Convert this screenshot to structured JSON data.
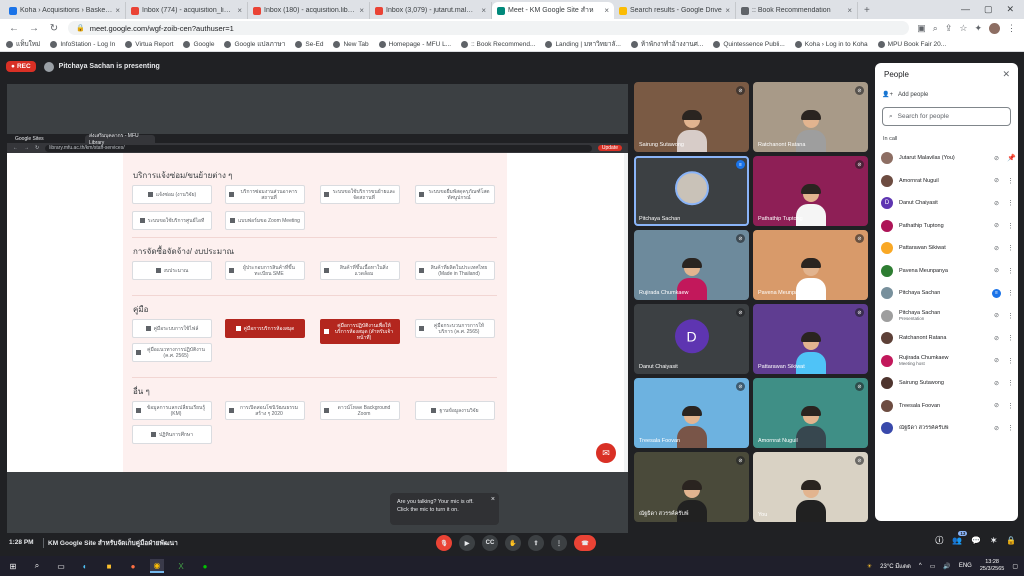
{
  "browser": {
    "tabs": [
      {
        "title": "Koha › Acquisitions › Basket PO:",
        "color": "#1a73e8"
      },
      {
        "title": "Inbox (774) - acquisition_library",
        "color": "#ea4335"
      },
      {
        "title": "Inbox (180) - acquisition.library",
        "color": "#ea4335"
      },
      {
        "title": "Inbox (3,079) - jutarut.mal@mfu",
        "color": "#ea4335"
      },
      {
        "title": "Meet - KM Google Site สำห",
        "color": "#00897b"
      },
      {
        "title": "Search results - Google Drive",
        "color": "#fbbc04"
      },
      {
        "title": ":: Book Recommendation",
        "color": "#5f6368"
      }
    ],
    "url": "meet.google.com/wgf-zoib-cen?authuser=1",
    "bookmarks": [
      "แท็บใหม่",
      "InfoStation - Log In",
      "Virtua Report",
      "Google",
      "Google แปลภาษา",
      "Se-Ed",
      "New Tab",
      "Homepage - MFU L...",
      ":: Book Recommend...",
      "Landing | มหาวิทยาลั...",
      "ห้าพักงาทำอ้างงานศ...",
      "Quintessence Publi...",
      "Koha › Log in to Koha",
      "MPU Book Fair 20..."
    ]
  },
  "meet": {
    "rec_label": "REC",
    "presenting_text": "Pitchaya Sachan is presenting",
    "shared": {
      "inner_tabs": [
        "Google Sites",
        "ส่งเสริมบุคลากร - MFU Library"
      ],
      "inner_url": "library.mfu.ac.th/km/staff-services/",
      "update_label": "Update",
      "sections": [
        {
          "title": "บริการแจ้งซ่อม/ขนย้ายต่าง ๆ",
          "cards": [
            {
              "text": "แจ้งซ่อม (งานวิจัย)",
              "red": false
            },
            {
              "text": "บริการซ่อมงานส่วนอาคารสถานที่",
              "red": false
            },
            {
              "text": "ระบบขอใช้บริการขนย้ายและจัดสถานที่",
              "red": false
            },
            {
              "text": "ระบบขอยืมพัสดุครุภัณฑ์โสตทัศนูปกรณ์",
              "red": false
            },
            {
              "text": "ระบบขอใช้บริการศูนย์ไอที",
              "red": false
            },
            {
              "text": "แบบฟอร์มขอ Zoom Meeting",
              "red": false
            }
          ]
        },
        {
          "title": "การจัดซื้อจัดจ้าง/ งบประมาณ",
          "cards": [
            {
              "text": "งบประมาณ",
              "red": false
            },
            {
              "text": "ผู้ประกอบการสินค้าที่ขึ้นทะเบียน SME",
              "red": false
            },
            {
              "text": "สินค้าที่ขึ้นเนื้อหาในสิ่งแวดล้อม",
              "red": false
            },
            {
              "text": "สินค้าที่ผลิตในประเทศไทย (Made in Thailand)",
              "red": false
            }
          ]
        },
        {
          "title": "คู่มือ",
          "cards": [
            {
              "text": "คู่มือระบบการใช้ไฟล์",
              "red": false
            },
            {
              "text": "คู่มือการบริการห้องสมุด",
              "red": true
            },
            {
              "text": "คู่มือการปฏิบัติงานเพื่อให้บริการห้องสมุด (สำหรับเจ้าหน้าที่)",
              "red": true
            },
            {
              "text": "คู่มือกระบวนการการให้บริการ (ค.ศ. 2565)",
              "red": false
            },
            {
              "text": "คู่มือแนวทางการปฏิบัติงาน (ค.ศ. 2565)",
              "red": false
            }
          ]
        },
        {
          "title": "อื่น ๆ",
          "cards": [
            {
              "text": "ข้อมูลการแลกเปลี่ยนเรียนรู้ (KM)",
              "red": false
            },
            {
              "text": "การเปิดสอนโซนิวัฒนธรรมสร้าง ๆ 2020",
              "red": false
            },
            {
              "text": "ดาวน์โหลด Background Zoom",
              "red": false
            },
            {
              "text": "ฐานข้อมูลงานวิจัย",
              "red": false
            },
            {
              "text": "ปฏิทินการศึกษา",
              "red": false
            }
          ]
        }
      ]
    },
    "tiles": [
      {
        "name": "Sairung Sutawong",
        "speaking": false,
        "avatar": "",
        "bg": "#7a5a44",
        "shirt": "#d7ccc8"
      },
      {
        "name": "Ratchanont Ratana",
        "speaking": false,
        "avatar": "",
        "bg": "#a89a88",
        "shirt": "#9e9e9e"
      },
      {
        "name": "Pitchaya Sachan",
        "speaking": true,
        "avatar": "",
        "bg": "#3c4043",
        "shirt": "#455a64"
      },
      {
        "name": "Pathathip Tuptong",
        "speaking": false,
        "avatar": "",
        "bg": "#8e1f56",
        "shirt": "#f5f5f5"
      },
      {
        "name": "Rujirada Chumkaew",
        "speaking": false,
        "avatar": "",
        "bg": "#6d8a9c",
        "shirt": "#c2185b"
      },
      {
        "name": "Pavena Meunpanya",
        "speaking": false,
        "avatar": "",
        "bg": "#d89a6a",
        "shirt": "#ffffff"
      },
      {
        "name": "Danut Chaiyasit",
        "speaking": false,
        "avatar": "D",
        "bg": "#3c4043",
        "shirt": ""
      },
      {
        "name": "Pattarawan Sikiwat",
        "speaking": false,
        "avatar": "",
        "bg": "#5f3d91",
        "shirt": "#4fc3f7"
      },
      {
        "name": "Treesala Foovan",
        "speaking": false,
        "avatar": "",
        "bg": "#6db2e0",
        "shirt": "#795548"
      },
      {
        "name": "Amornrat Nuguil",
        "speaking": false,
        "avatar": "",
        "bg": "#3f8f86",
        "shirt": "#37474f"
      },
      {
        "name": "ณัฐธิดา สวรรค์ครับพ์",
        "speaking": false,
        "avatar": "",
        "bg": "#4a4a3a",
        "shirt": "#212121"
      },
      {
        "name": "You",
        "speaking": false,
        "avatar": "",
        "bg": "#d9d2c4",
        "shirt": "#212121"
      }
    ],
    "toast": {
      "line1": "Are you talking? Your mic is off.",
      "line2": "Click the mic to turn it on."
    },
    "bottom": {
      "time": "1:28 PM",
      "meeting_title": "KM Google Site สำหรับจัดเก็บคู่มือฝ่ายพัฒนา",
      "participant_count": "13"
    }
  },
  "people_panel": {
    "title": "People",
    "add_people": "Add people",
    "search_placeholder": "Search for people",
    "in_call_label": "In call",
    "people": [
      {
        "name": "Jutarut Malavilas (You)",
        "sub": "",
        "color": "#8d6e63",
        "initial": "",
        "pinned": true,
        "speaking": false
      },
      {
        "name": "Amornrat Nuguil",
        "sub": "",
        "color": "#6d4c41",
        "initial": "",
        "pinned": false,
        "speaking": false
      },
      {
        "name": "Danut Chaiyasit",
        "sub": "",
        "color": "#5e35b1",
        "initial": "D",
        "pinned": false,
        "speaking": false
      },
      {
        "name": "Pathathip Tuptong",
        "sub": "",
        "color": "#ad1457",
        "initial": "",
        "pinned": false,
        "speaking": false
      },
      {
        "name": "Pattarawan Sikiwat",
        "sub": "",
        "color": "#f9a825",
        "initial": "",
        "pinned": false,
        "speaking": false
      },
      {
        "name": "Pavena Meunpanya",
        "sub": "",
        "color": "#2e7d32",
        "initial": "",
        "pinned": false,
        "speaking": false
      },
      {
        "name": "Pitchaya Sachan",
        "sub": "",
        "color": "#78909c",
        "initial": "",
        "pinned": false,
        "speaking": true
      },
      {
        "name": "Pitchaya Sachan",
        "sub": "Presentation",
        "color": "#9e9e9e",
        "initial": "",
        "pinned": false,
        "speaking": false
      },
      {
        "name": "Ratchanont Ratana",
        "sub": "",
        "color": "#5d4037",
        "initial": "",
        "pinned": false,
        "speaking": false
      },
      {
        "name": "Rujirada Chumkaew",
        "sub": "Meeting host",
        "color": "#c2185b",
        "initial": "",
        "pinned": false,
        "speaking": false
      },
      {
        "name": "Sairung Sutawong",
        "sub": "",
        "color": "#4e342e",
        "initial": "",
        "pinned": false,
        "speaking": false
      },
      {
        "name": "Treesala Foovan",
        "sub": "",
        "color": "#6d4c41",
        "initial": "",
        "pinned": false,
        "speaking": false
      },
      {
        "name": "ณัฐธิดา สวรรค์ครับพ์",
        "sub": "",
        "color": "#3949ab",
        "initial": "",
        "pinned": false,
        "speaking": false
      }
    ]
  },
  "taskbar": {
    "weather": "23°C มีแดด",
    "lang": "ENG",
    "time": "13:28",
    "date": "25/3/2565"
  }
}
